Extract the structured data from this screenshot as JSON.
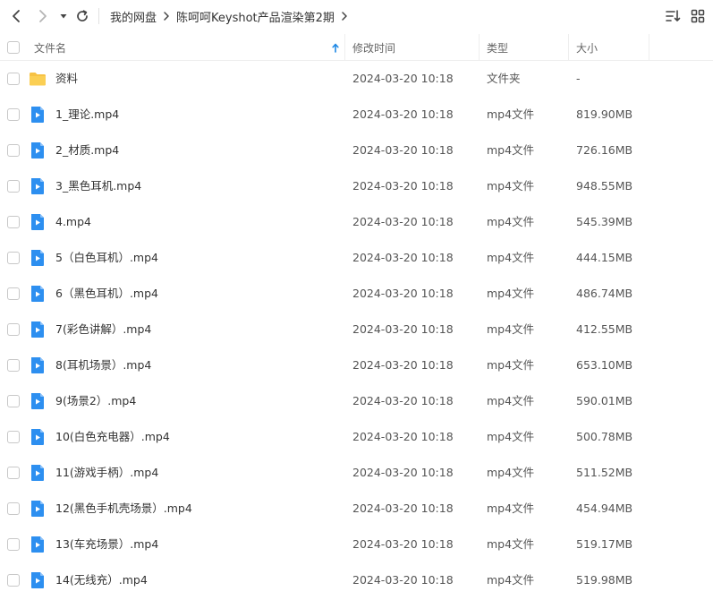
{
  "breadcrumb": {
    "items": [
      "我的网盘",
      "陈呵呵Keyshot产品渲染第2期"
    ]
  },
  "header": {
    "name": "文件名",
    "modified": "修改时间",
    "type": "类型",
    "size": "大小"
  },
  "icons": {
    "back": "chevron-left-icon",
    "forward": "chevron-right-icon",
    "history": "caret-down-icon",
    "refresh": "refresh-icon",
    "sort": "sort-icon",
    "grid": "grid-view-icon"
  },
  "files": [
    {
      "name": "资料",
      "time": "2024-03-20 10:18",
      "type": "文件夹",
      "size": "-",
      "kind": "folder"
    },
    {
      "name": "1_理论.mp4",
      "time": "2024-03-20 10:18",
      "type": "mp4文件",
      "size": "819.90MB",
      "kind": "video"
    },
    {
      "name": "2_材质.mp4",
      "time": "2024-03-20 10:18",
      "type": "mp4文件",
      "size": "726.16MB",
      "kind": "video"
    },
    {
      "name": "3_黑色耳机.mp4",
      "time": "2024-03-20 10:18",
      "type": "mp4文件",
      "size": "948.55MB",
      "kind": "video"
    },
    {
      "name": "4.mp4",
      "time": "2024-03-20 10:18",
      "type": "mp4文件",
      "size": "545.39MB",
      "kind": "video"
    },
    {
      "name": "5（白色耳机）.mp4",
      "time": "2024-03-20 10:18",
      "type": "mp4文件",
      "size": "444.15MB",
      "kind": "video"
    },
    {
      "name": "6（黑色耳机）.mp4",
      "time": "2024-03-20 10:18",
      "type": "mp4文件",
      "size": "486.74MB",
      "kind": "video"
    },
    {
      "name": "7(彩色讲解）.mp4",
      "time": "2024-03-20 10:18",
      "type": "mp4文件",
      "size": "412.55MB",
      "kind": "video"
    },
    {
      "name": "8(耳机场景）.mp4",
      "time": "2024-03-20 10:18",
      "type": "mp4文件",
      "size": "653.10MB",
      "kind": "video"
    },
    {
      "name": "9(场景2）.mp4",
      "time": "2024-03-20 10:18",
      "type": "mp4文件",
      "size": "590.01MB",
      "kind": "video"
    },
    {
      "name": "10(白色充电器）.mp4",
      "time": "2024-03-20 10:18",
      "type": "mp4文件",
      "size": "500.78MB",
      "kind": "video"
    },
    {
      "name": "11(游戏手柄）.mp4",
      "time": "2024-03-20 10:18",
      "type": "mp4文件",
      "size": "511.52MB",
      "kind": "video"
    },
    {
      "name": "12(黑色手机壳场景）.mp4",
      "time": "2024-03-20 10:18",
      "type": "mp4文件",
      "size": "454.94MB",
      "kind": "video"
    },
    {
      "name": "13(车充场景）.mp4",
      "time": "2024-03-20 10:18",
      "type": "mp4文件",
      "size": "519.17MB",
      "kind": "video"
    },
    {
      "name": "14(无线充）.mp4",
      "time": "2024-03-20 10:18",
      "type": "mp4文件",
      "size": "519.98MB",
      "kind": "video"
    }
  ],
  "colors": {
    "accent": "#1e88e5",
    "folder": "#f7c244",
    "video": "#2d8ff0"
  }
}
